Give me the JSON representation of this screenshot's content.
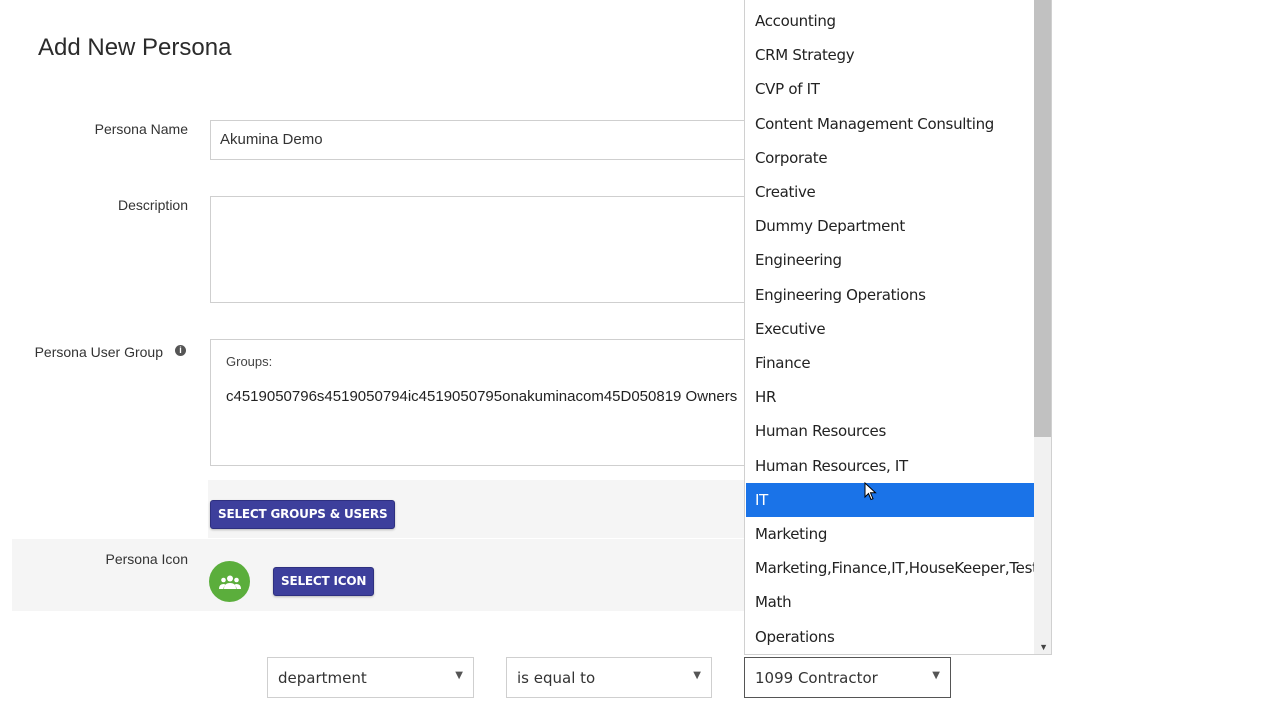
{
  "page": {
    "title": "Add New Persona"
  },
  "form": {
    "persona_name_label": "Persona Name",
    "persona_name_value": "Akumina Demo",
    "description_label": "Description",
    "description_value": "",
    "user_group_label": "Persona User Group",
    "groups_label": "Groups:",
    "groups_value": "c4519050796s4519050794ic4519050795onakuminacom45D050819 Owners",
    "select_groups_button": "SELECT GROUPS & USERS",
    "persona_icon_label": "Persona Icon",
    "select_icon_button": "SELECT ICON"
  },
  "rule": {
    "field": "department",
    "operator": "is equal to",
    "value": "1099 Contractor"
  },
  "dropdown": {
    "options": [
      "Accounting",
      "CRM Strategy",
      "CVP of IT",
      "Content Management Consulting",
      "Corporate",
      "Creative",
      "Dummy Department",
      "Engineering",
      "Engineering Operations",
      "Executive",
      "Finance",
      "HR",
      "Human Resources",
      "Human Resources, IT",
      "IT",
      "Marketing",
      "Marketing,Finance,IT,HouseKeeper,Test",
      "Math",
      "Operations"
    ],
    "highlighted": "IT"
  },
  "icons": {
    "info": "info-icon",
    "persona": "group-icon",
    "select_arrow": "chevron-down-icon"
  },
  "colors": {
    "button": "#3d3f9c",
    "highlight": "#1a73e8",
    "persona_icon": "#5bae3c"
  }
}
